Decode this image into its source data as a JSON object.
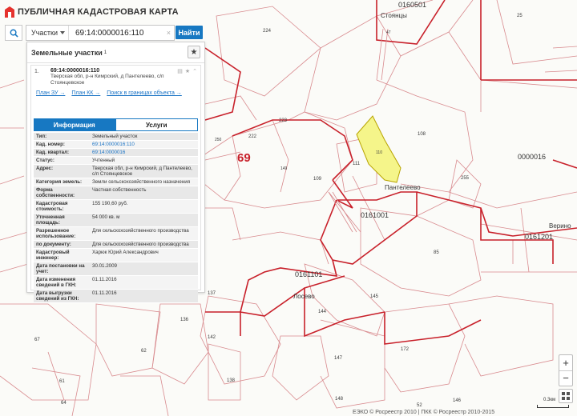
{
  "header": {
    "title": "ПУБЛИЧНАЯ КАДАСТРОВАЯ КАРТА"
  },
  "search": {
    "type_select": "Участки",
    "query": "69:14:0000016:110",
    "clear": "×",
    "find_button": "Найти"
  },
  "panel": {
    "title": "Земельные участки",
    "count": "1",
    "result": {
      "number": "1.",
      "cad_number": "69:14:0000016:110",
      "address": "Тверская обл, р-н Кимрский, д Пантелеево, с/п Стоянцевское",
      "links": [
        "План ЗУ →",
        "План КК →",
        "Поиск в границах объекта →"
      ]
    },
    "tabs": [
      "Информация",
      "Услуги"
    ],
    "rows": [
      {
        "k": "Тип:",
        "v": "Земельный участок",
        "link": false
      },
      {
        "k": "Кад. номер:",
        "v": "69:14:0000016:110",
        "link": true
      },
      {
        "k": "Кад. квартал:",
        "v": "69:14:0000016",
        "link": true
      },
      {
        "k": "Статус:",
        "v": "Учтенный",
        "link": false
      },
      {
        "k": "Адрес:",
        "v": "Тверская обл, р-н Кимрский, д Пантелеево, с/п Стоянцевское",
        "link": false
      },
      {
        "k": "Категория земель:",
        "v": "Земли сельскохозяйственного назначения",
        "link": false
      },
      {
        "k": "Форма собственности:",
        "v": "Частная собственность",
        "link": false
      },
      {
        "k": "Кадастровая стоимость:",
        "v": "155 190,60 руб.",
        "link": false
      },
      {
        "k": "Уточненная площадь:",
        "v": "54 000 кв. м",
        "link": false
      },
      {
        "k": "Разрешенное использование:",
        "v": "Для сельскохозяйственного производства",
        "link": false
      },
      {
        "k": "по документу:",
        "v": "Для сельскохозяйственного производства",
        "link": false
      },
      {
        "k": "Кадастровый инженер:",
        "v": "Харюк Юрий Александрович",
        "link": false
      },
      {
        "k": "Дата постановки на учет:",
        "v": "30.01.2009",
        "link": false
      },
      {
        "k": "Дата изменения сведений в ГКН:",
        "v": "01.11.2016",
        "link": false
      },
      {
        "k": "Дата выгрузки сведений из ГКН:",
        "v": "01.11.2016",
        "link": false
      }
    ]
  },
  "map": {
    "highlight_color": "#f5f58a",
    "boundary_color": "#c8202a",
    "labels": {
      "big": "69",
      "q1": "0160501",
      "q2": "0000016",
      "q3": "0161001",
      "q4": "0161101",
      "q5": "0161201",
      "v1": "Стоянцы",
      "v2": "Пантелеево",
      "v3": "Лосево",
      "v4": "Верино",
      "p224": "224",
      "p25": "25",
      "p47": "47",
      "p223": "223",
      "p222": "222",
      "p250": "250",
      "p149": "149",
      "p109": "109",
      "p111": "111",
      "p110": "110",
      "p108": "108",
      "p255": "255",
      "p85": "85",
      "p145": "145",
      "p144": "144",
      "p137": "137",
      "p136": "136",
      "p142": "142",
      "p67": "67",
      "p62": "62",
      "p147": "147",
      "p172": "172",
      "p61": "61",
      "p64": "64",
      "p138": "138",
      "p146": "146",
      "p148": "148",
      "p52": "52"
    }
  },
  "footer": {
    "attribution": "ЕЭКО © Росреестр 2010 | ПКК © Росреестр 2010-2015",
    "scale": "0.3км"
  }
}
